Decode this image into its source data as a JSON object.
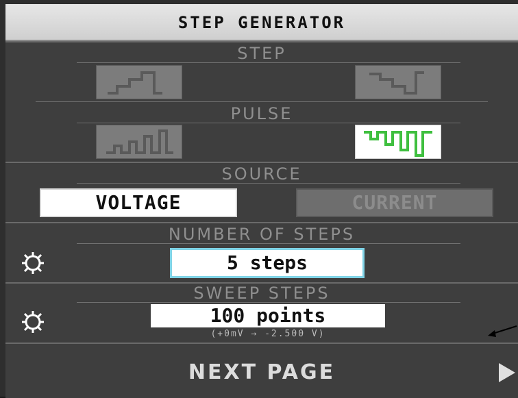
{
  "title": "STEP GENERATOR",
  "step_section": {
    "label": "STEP",
    "options": [
      {
        "icon": "step-up-waveform-icon",
        "selected": false
      },
      {
        "icon": "step-down-waveform-icon",
        "selected": false
      }
    ]
  },
  "pulse_section": {
    "label": "PULSE",
    "options": [
      {
        "icon": "pulse-up-waveform-icon",
        "selected": false
      },
      {
        "icon": "pulse-down-waveform-icon",
        "selected": true
      }
    ]
  },
  "source": {
    "label": "SOURCE",
    "voltage_label": "VOLTAGE",
    "current_label": "CURRENT",
    "selected": "VOLTAGE"
  },
  "number_of_steps": {
    "label": "NUMBER OF STEPS",
    "value": "5 steps"
  },
  "sweep_steps": {
    "label": "SWEEP STEPS",
    "value": "100 points",
    "range": "(+0mV → -2.500 V)"
  },
  "next_page": {
    "label": "NEXT PAGE"
  },
  "colors": {
    "panel_bg": "#3e3e3e",
    "label_gray": "#8f8f8f",
    "selected_wave": "#3fbf3f",
    "focus_border": "#7fd3e6"
  }
}
